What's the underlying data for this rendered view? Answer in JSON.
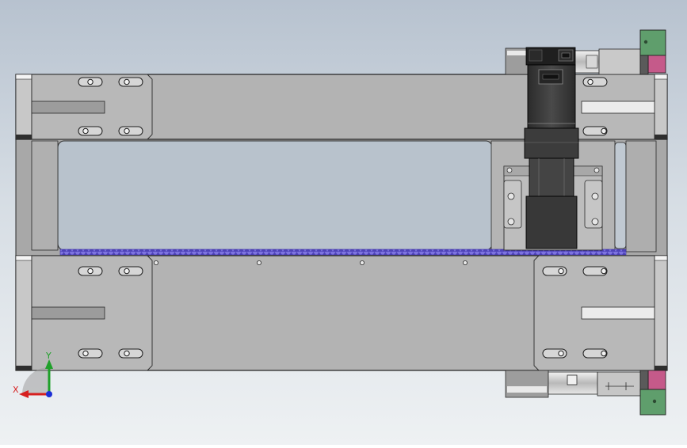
{
  "triad": {
    "x_label": "X",
    "y_label": "Y",
    "x_color": "#d61f1f",
    "y_color": "#1fa02a",
    "z_color": "#1c2fd6"
  },
  "colors": {
    "plate": "#b3b3b3",
    "plate_dark": "#a9a9a9",
    "bracket": "#bcbcbc",
    "slot": "#9c9c9c",
    "motor": "#3a3a3a",
    "motor_dark": "#1e1e1e",
    "gear_rack": "#6a5fd6",
    "terminal_green": "#5f9e6c",
    "terminal_pink": "#b5527e"
  },
  "icons": {
    "motor": "servo-motor-icon",
    "triad": "axis-triad-icon"
  }
}
